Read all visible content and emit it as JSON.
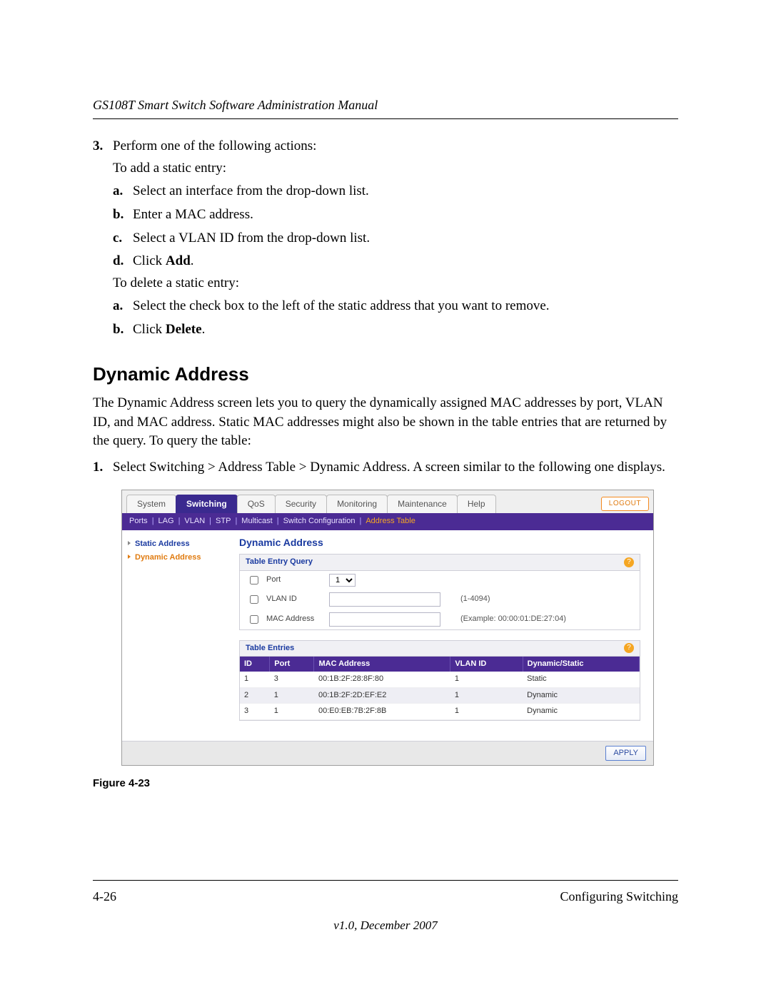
{
  "header": {
    "title": "GS108T Smart Switch Software Administration Manual"
  },
  "content": {
    "step3_label": "3.",
    "step3_text": "Perform one of the following actions:",
    "add_intro": "To add a static entry:",
    "add_a_label": "a.",
    "add_a_text": "Select an interface from the drop-down list.",
    "add_b_label": "b.",
    "add_b_text": "Enter a MAC address.",
    "add_c_label": "c.",
    "add_c_text": "Select a VLAN ID from the drop-down list.",
    "add_d_label": "d.",
    "add_d_pre": "Click ",
    "add_d_bold": "Add",
    "add_d_post": ".",
    "del_intro": "To delete a static entry:",
    "del_a_label": "a.",
    "del_a_text": "Select the check box to the left of the static address that you want to remove.",
    "del_b_label": "b.",
    "del_b_pre": "Click ",
    "del_b_bold": "Delete",
    "del_b_post": ".",
    "section_heading": "Dynamic Address",
    "section_para": "The Dynamic Address screen lets you to query the dynamically assigned MAC addresses by port, VLAN ID, and MAC address. Static MAC addresses might also be shown in the table entries that are returned by the query. To query the table:",
    "step1_label": "1.",
    "step1_text": "Select Switching > Address Table > Dynamic Address. A screen similar to the following one displays.",
    "figure_caption": "Figure 4-23"
  },
  "screenshot": {
    "tabs": {
      "system": "System",
      "switching": "Switching",
      "qos": "QoS",
      "security": "Security",
      "monitoring": "Monitoring",
      "maintenance": "Maintenance",
      "help": "Help"
    },
    "logout": "LOGOUT",
    "subnav": {
      "ports": "Ports",
      "lag": "LAG",
      "vlan": "VLAN",
      "stp": "STP",
      "multicast": "Multicast",
      "switchconf": "Switch Configuration",
      "addrtable": "Address Table"
    },
    "sidebar": {
      "static": "Static Address",
      "dynamic": "Dynamic Address"
    },
    "panel": {
      "title": "Dynamic Address",
      "query_title": "Table Entry Query",
      "port_label": "Port",
      "port_value": "1",
      "vlan_label": "VLAN ID",
      "vlan_hint": "(1-4094)",
      "mac_label": "MAC Address",
      "mac_hint": "(Example: 00:00:01:DE:27:04)",
      "entries_title": "Table Entries",
      "help_icon": "?",
      "cols": {
        "id": "ID",
        "port": "Port",
        "mac": "MAC Address",
        "vlan": "VLAN ID",
        "dyn": "Dynamic/Static"
      },
      "rows": [
        {
          "id": "1",
          "port": "3",
          "mac": "00:1B:2F:28:8F:80",
          "vlan": "1",
          "dyn": "Static"
        },
        {
          "id": "2",
          "port": "1",
          "mac": "00:1B:2F:2D:EF:E2",
          "vlan": "1",
          "dyn": "Dynamic"
        },
        {
          "id": "3",
          "port": "1",
          "mac": "00:E0:EB:7B:2F:8B",
          "vlan": "1",
          "dyn": "Dynamic"
        }
      ],
      "apply": "APPLY"
    }
  },
  "footer": {
    "page_num": "4-26",
    "section": "Configuring Switching",
    "version": "v1.0, December 2007"
  }
}
